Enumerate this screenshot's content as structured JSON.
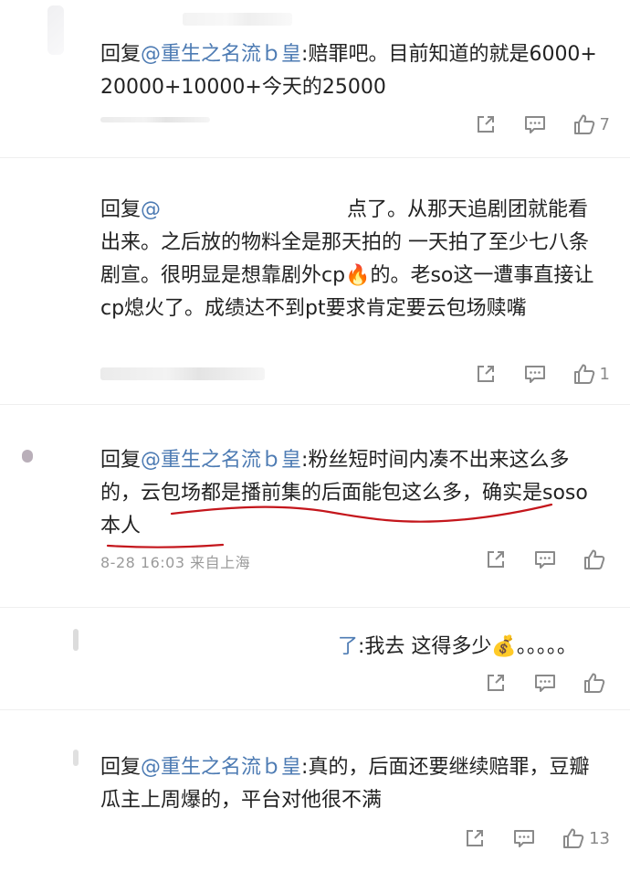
{
  "replies": [
    {
      "prefix": "回复",
      "mention": "@重生之名流ｂ皇",
      "text": ":赔罪吧。目前知道的就是6000+20000+10000+今天的25000",
      "meta": "",
      "share_icon": "share-icon",
      "comment_icon": "comment-icon",
      "like_icon": "thumbs-up-icon",
      "likes": "7"
    },
    {
      "prefix": "回复",
      "mention": "@",
      "text": "点了。从那天追剧团就能看出来。之后放的物料全是那天拍的 一天拍了至少七八条剧宣。很明显是想靠剧外cp🔥的。老so这一遭事直接让cp熄火了。成绩达不到pt要求肯定要云包场赎嘴",
      "meta": "",
      "likes": "1"
    },
    {
      "prefix": "回复",
      "mention": "@重生之名流ｂ皇",
      "text": ":粉丝短时间内凑不出来这么多的，云包场都是播前集的后面能包这么多，确实是soso本人",
      "meta": "8-28 16:03 来自上海",
      "likes": ""
    },
    {
      "prefix": "",
      "mention": "了",
      "text": ":我去 这得多少💰。。。。。",
      "meta": "",
      "likes": ""
    },
    {
      "prefix": "回复",
      "mention": "@重生之名流ｂ皇",
      "text": ":真的，后面还要继续赔罪，豆瓣瓜主上周爆的，平台对他很不满",
      "meta": "",
      "likes": "13"
    }
  ],
  "colors": {
    "mention": "#4d7bb3",
    "text": "#222222",
    "meta": "#9a9a9a",
    "icon": "#8a8a8a",
    "underline": "#c4161c"
  }
}
